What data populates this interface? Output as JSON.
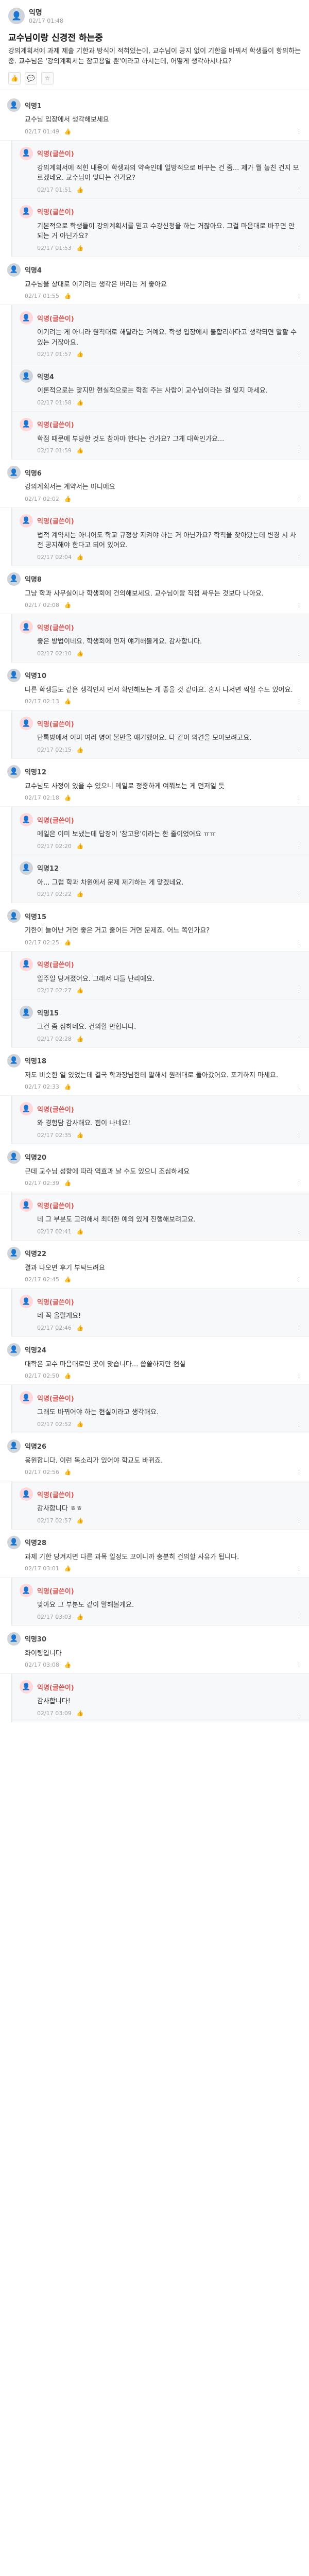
{
  "post": {
    "author": "익명",
    "date": "02/17 01:48",
    "title": "교수님이랑 신경전 하는중",
    "body": "강의계획서에 과제 제출 기한과 방식이 적혀있는데, 교수님이 공지 없이 기한을 바꿔서 학생들이 항의하는 중. 교수님은 '강의계획서는 참고용일 뿐'이라고 하시는데, 어떻게 생각하시나요?",
    "icons": {
      "like": "thumbs-up-icon",
      "comment": "comment-icon",
      "scrap": "star-icon"
    }
  },
  "comments": [
    {
      "name": "익명1",
      "writer": false,
      "reply": false,
      "text": "교수님 입장에서 생각해보세요",
      "date": "02/17 01:49",
      "likes": ""
    },
    {
      "name": "익명(글쓴이)",
      "writer": true,
      "reply": true,
      "text": "강의계획서에 적힌 내용이 학생과의 약속인데 일방적으로 바꾸는 건 좀... 제가 뭘 놓친 건지 모르겠네요. 교수님이 맞다는 건가요?",
      "date": "02/17 01:51",
      "likes": ""
    },
    {
      "name": "익명(글쓴이)",
      "writer": true,
      "reply": true,
      "text": "기본적으로 학생들이 강의계획서를 믿고 수강신청을 하는 거잖아요. 그걸 마음대로 바꾸면 안 되는 거 아닌가요?",
      "date": "02/17 01:53",
      "likes": ""
    },
    {
      "name": "익명4",
      "writer": false,
      "reply": false,
      "text": "교수님을 상대로 이기려는 생각은 버리는 게 좋아요",
      "date": "02/17 01:55",
      "likes": ""
    },
    {
      "name": "익명(글쓴이)",
      "writer": true,
      "reply": true,
      "text": "이기려는 게 아니라 원칙대로 해달라는 거예요. 학생 입장에서 불합리하다고 생각되면 말할 수 있는 거잖아요.",
      "date": "02/17 01:57",
      "likes": ""
    },
    {
      "name": "익명4",
      "writer": false,
      "reply": true,
      "text": "이론적으로는 맞지만 현실적으로는 학점 주는 사람이 교수님이라는 걸 잊지 마세요.",
      "date": "02/17 01:58",
      "likes": ""
    },
    {
      "name": "익명(글쓴이)",
      "writer": true,
      "reply": true,
      "text": "학점 때문에 부당한 것도 참아야 한다는 건가요? 그게 대학인가요...",
      "date": "02/17 01:59",
      "likes": ""
    },
    {
      "name": "익명6",
      "writer": false,
      "reply": false,
      "text": "강의계획서는 계약서는 아니에요",
      "date": "02/17 02:02",
      "likes": ""
    },
    {
      "name": "익명(글쓴이)",
      "writer": true,
      "reply": true,
      "text": "법적 계약서는 아니어도 학교 규정상 지켜야 하는 거 아닌가요? 학칙을 찾아봤는데 변경 시 사전 공지해야 한다고 되어 있어요.",
      "date": "02/17 02:04",
      "likes": ""
    },
    {
      "name": "익명8",
      "writer": false,
      "reply": false,
      "text": "그냥 학과 사무실이나 학생회에 건의해보세요. 교수님이랑 직접 싸우는 것보다 나아요.",
      "date": "02/17 02:08",
      "likes": ""
    },
    {
      "name": "익명(글쓴이)",
      "writer": true,
      "reply": true,
      "text": "좋은 방법이네요. 학생회에 먼저 얘기해볼게요. 감사합니다.",
      "date": "02/17 02:10",
      "likes": ""
    },
    {
      "name": "익명10",
      "writer": false,
      "reply": false,
      "text": "다른 학생들도 같은 생각인지 먼저 확인해보는 게 좋을 것 같아요. 혼자 나서면 찍힐 수도 있어요.",
      "date": "02/17 02:13",
      "likes": ""
    },
    {
      "name": "익명(글쓴이)",
      "writer": true,
      "reply": true,
      "text": "단톡방에서 이미 여러 명이 불만을 얘기했어요. 다 같이 의견을 모아보려고요.",
      "date": "02/17 02:15",
      "likes": ""
    },
    {
      "name": "익명12",
      "writer": false,
      "reply": false,
      "text": "교수님도 사정이 있을 수 있으니 메일로 정중하게 여쭤보는 게 먼저일 듯",
      "date": "02/17 02:18",
      "likes": ""
    },
    {
      "name": "익명(글쓴이)",
      "writer": true,
      "reply": true,
      "text": "메일은 이미 보냈는데 답장이 '참고용'이라는 한 줄이었어요 ㅠㅠ",
      "date": "02/17 02:20",
      "likes": ""
    },
    {
      "name": "익명12",
      "writer": false,
      "reply": true,
      "text": "아... 그럼 학과 차원에서 문제 제기하는 게 맞겠네요.",
      "date": "02/17 02:22",
      "likes": ""
    },
    {
      "name": "익명15",
      "writer": false,
      "reply": false,
      "text": "기한이 늘어난 거면 좋은 거고 줄어든 거면 문제죠. 어느 쪽인가요?",
      "date": "02/17 02:25",
      "likes": ""
    },
    {
      "name": "익명(글쓴이)",
      "writer": true,
      "reply": true,
      "text": "일주일 당겨졌어요. 그래서 다들 난리예요.",
      "date": "02/17 02:27",
      "likes": ""
    },
    {
      "name": "익명15",
      "writer": false,
      "reply": true,
      "text": "그건 좀 심하네요. 건의할 만합니다.",
      "date": "02/17 02:28",
      "likes": ""
    },
    {
      "name": "익명18",
      "writer": false,
      "reply": false,
      "text": "저도 비슷한 일 있었는데 결국 학과장님한테 말해서 원래대로 돌아갔어요. 포기하지 마세요.",
      "date": "02/17 02:33",
      "likes": ""
    },
    {
      "name": "익명(글쓴이)",
      "writer": true,
      "reply": true,
      "text": "와 경험담 감사해요. 힘이 나네요!",
      "date": "02/17 02:35",
      "likes": ""
    },
    {
      "name": "익명20",
      "writer": false,
      "reply": false,
      "text": "근데 교수님 성향에 따라 역효과 날 수도 있으니 조심하세요",
      "date": "02/17 02:39",
      "likes": ""
    },
    {
      "name": "익명(글쓴이)",
      "writer": true,
      "reply": true,
      "text": "네 그 부분도 고려해서 최대한 예의 있게 진행해보려고요.",
      "date": "02/17 02:41",
      "likes": ""
    },
    {
      "name": "익명22",
      "writer": false,
      "reply": false,
      "text": "결과 나오면 후기 부탁드려요",
      "date": "02/17 02:45",
      "likes": ""
    },
    {
      "name": "익명(글쓴이)",
      "writer": true,
      "reply": true,
      "text": "네 꼭 올릴게요!",
      "date": "02/17 02:46",
      "likes": ""
    },
    {
      "name": "익명24",
      "writer": false,
      "reply": false,
      "text": "대학은 교수 마음대로인 곳이 맞습니다... 씁쓸하지만 현실",
      "date": "02/17 02:50",
      "likes": ""
    },
    {
      "name": "익명(글쓴이)",
      "writer": true,
      "reply": true,
      "text": "그래도 바뀌어야 하는 현실이라고 생각해요.",
      "date": "02/17 02:52",
      "likes": ""
    },
    {
      "name": "익명26",
      "writer": false,
      "reply": false,
      "text": "응원합니다. 이런 목소리가 있어야 학교도 바뀌죠.",
      "date": "02/17 02:56",
      "likes": ""
    },
    {
      "name": "익명(글쓴이)",
      "writer": true,
      "reply": true,
      "text": "감사합니다 ㅎㅎ",
      "date": "02/17 02:57",
      "likes": ""
    },
    {
      "name": "익명28",
      "writer": false,
      "reply": false,
      "text": "과제 기한 당겨지면 다른 과목 일정도 꼬이니까 충분히 건의할 사유가 됩니다.",
      "date": "02/17 03:01",
      "likes": ""
    },
    {
      "name": "익명(글쓴이)",
      "writer": true,
      "reply": true,
      "text": "맞아요 그 부분도 같이 말해볼게요.",
      "date": "02/17 03:03",
      "likes": ""
    },
    {
      "name": "익명30",
      "writer": false,
      "reply": false,
      "text": "화이팅입니다",
      "date": "02/17 03:08",
      "likes": ""
    },
    {
      "name": "익명(글쓴이)",
      "writer": true,
      "reply": true,
      "text": "감사합니다!",
      "date": "02/17 03:09",
      "likes": ""
    }
  ]
}
